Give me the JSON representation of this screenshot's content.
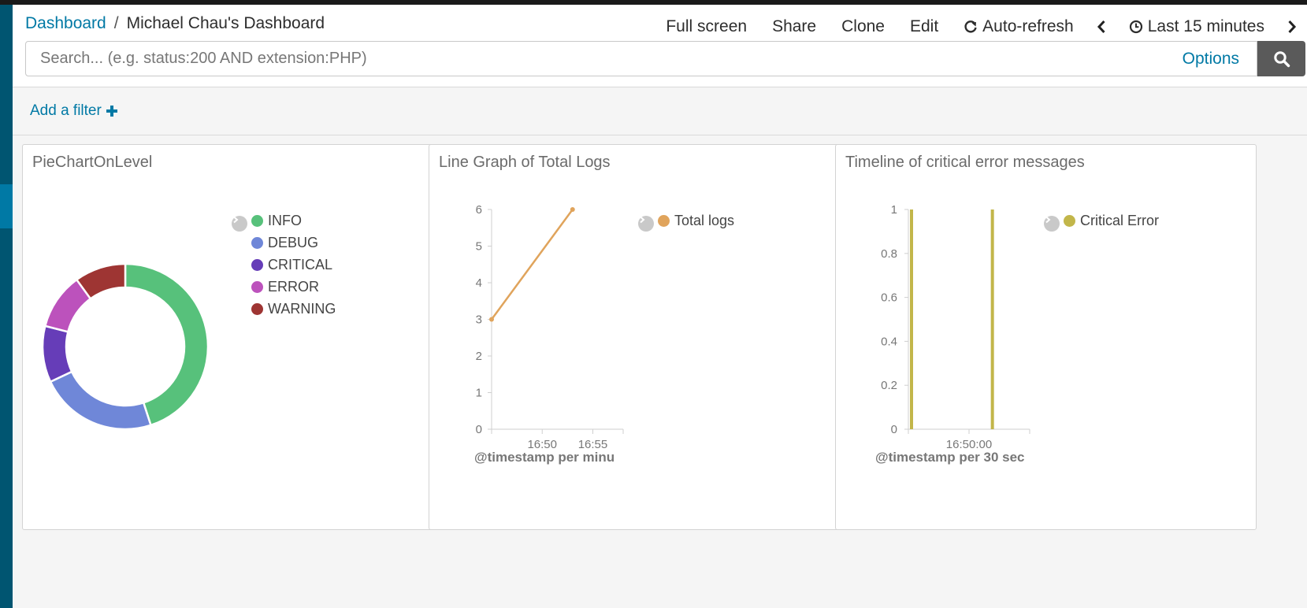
{
  "breadcrumb": {
    "root": "Dashboard",
    "separator": "/",
    "current": "Michael Chau's Dashboard"
  },
  "menu": {
    "full_screen": "Full screen",
    "share": "Share",
    "clone": "Clone",
    "edit": "Edit",
    "auto_refresh": "Auto-refresh",
    "time_range": "Last 15 minutes"
  },
  "search": {
    "placeholder": "Search... (e.g. status:200 AND extension:PHP)",
    "value": "",
    "options_label": "Options"
  },
  "filter": {
    "add_label": "Add a filter"
  },
  "colors": {
    "link": "#0079a5",
    "sidebar": "#005571",
    "info": "#57c17b",
    "debug": "#6f87d8",
    "critical": "#663db8",
    "error": "#bc52bc",
    "warning": "#9e3533",
    "total": "#e0a45c",
    "critical_error": "#c2b64a"
  },
  "panels": [
    {
      "title": "PieChartOnLevel"
    },
    {
      "title": "Line Graph of Total Logs"
    },
    {
      "title": "Timeline of critical error messages"
    }
  ],
  "chart_data": [
    {
      "type": "pie",
      "title": "PieChartOnLevel",
      "donut": true,
      "legend_position": "top-right",
      "slices": [
        {
          "label": "INFO",
          "value": 45,
          "color": "#57c17b"
        },
        {
          "label": "DEBUG",
          "value": 23,
          "color": "#6f87d8"
        },
        {
          "label": "CRITICAL",
          "value": 11,
          "color": "#663db8"
        },
        {
          "label": "ERROR",
          "value": 11,
          "color": "#bc52bc"
        },
        {
          "label": "WARNING",
          "value": 10,
          "color": "#9e3533"
        }
      ]
    },
    {
      "type": "line",
      "title": "Line Graph of Total Logs",
      "xlabel": "@timestamp per minu",
      "ylabel": "",
      "ylim": [
        0,
        6
      ],
      "yticks": [
        0,
        1,
        2,
        3,
        4,
        5,
        6
      ],
      "xlim": [
        "16:45",
        "16:58"
      ],
      "xticks": [
        "16:50",
        "16:55"
      ],
      "legend_position": "top-right",
      "series": [
        {
          "name": "Total logs",
          "color": "#e0a45c",
          "points": [
            {
              "x": "16:45",
              "y": 3
            },
            {
              "x": "16:53",
              "y": 6
            }
          ]
        }
      ]
    },
    {
      "type": "bar",
      "title": "Timeline of critical error messages",
      "xlabel": "@timestamp per 30 sec",
      "ylabel": "",
      "ylim": [
        0,
        1
      ],
      "yticks": [
        "0",
        "0.2",
        "0.4",
        "0.6",
        "0.8",
        "1"
      ],
      "xlim": [
        "16:48:30",
        "16:51:30"
      ],
      "xticks": [
        "16:50:00"
      ],
      "legend_position": "top-right",
      "series": [
        {
          "name": "Critical Error",
          "color": "#c2b64a",
          "points": [
            {
              "x": "16:48:30",
              "y": 1
            },
            {
              "x": "16:50:30",
              "y": 1
            }
          ]
        }
      ]
    }
  ]
}
